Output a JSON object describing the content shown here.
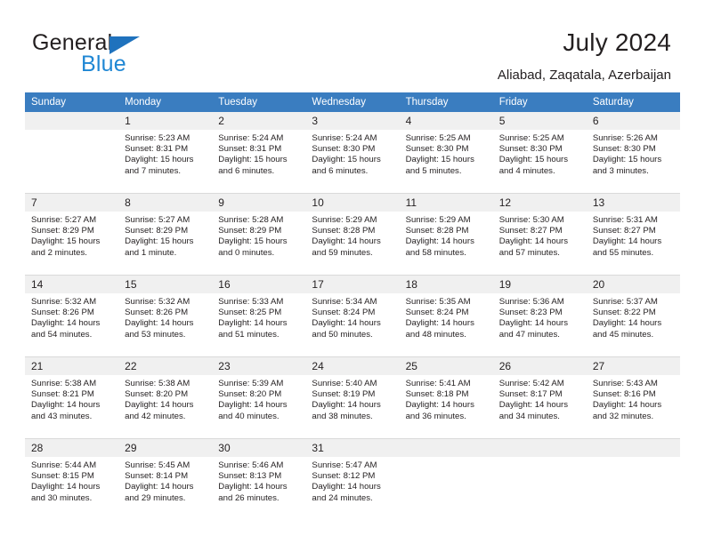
{
  "brand": {
    "name_top": "General",
    "name_bottom": "Blue",
    "accent_color": "#1f87d4",
    "triangle_color": "#1f72bd"
  },
  "header": {
    "title": "July 2024",
    "subtitle": "Aliabad, Zaqatala, Azerbaijan"
  },
  "calendar": {
    "header_bg": "#3a7dc0",
    "daynum_bg": "#f0f0f0",
    "weekday_headers": [
      "Sunday",
      "Monday",
      "Tuesday",
      "Wednesday",
      "Thursday",
      "Friday",
      "Saturday"
    ],
    "weeks": [
      [
        {
          "day": "",
          "sunrise": "",
          "sunset": "",
          "daylight_line1": "",
          "daylight_line2": "",
          "empty": true
        },
        {
          "day": "1",
          "sunrise": "Sunrise: 5:23 AM",
          "sunset": "Sunset: 8:31 PM",
          "daylight_line1": "Daylight: 15 hours",
          "daylight_line2": "and 7 minutes."
        },
        {
          "day": "2",
          "sunrise": "Sunrise: 5:24 AM",
          "sunset": "Sunset: 8:31 PM",
          "daylight_line1": "Daylight: 15 hours",
          "daylight_line2": "and 6 minutes."
        },
        {
          "day": "3",
          "sunrise": "Sunrise: 5:24 AM",
          "sunset": "Sunset: 8:30 PM",
          "daylight_line1": "Daylight: 15 hours",
          "daylight_line2": "and 6 minutes."
        },
        {
          "day": "4",
          "sunrise": "Sunrise: 5:25 AM",
          "sunset": "Sunset: 8:30 PM",
          "daylight_line1": "Daylight: 15 hours",
          "daylight_line2": "and 5 minutes."
        },
        {
          "day": "5",
          "sunrise": "Sunrise: 5:25 AM",
          "sunset": "Sunset: 8:30 PM",
          "daylight_line1": "Daylight: 15 hours",
          "daylight_line2": "and 4 minutes."
        },
        {
          "day": "6",
          "sunrise": "Sunrise: 5:26 AM",
          "sunset": "Sunset: 8:30 PM",
          "daylight_line1": "Daylight: 15 hours",
          "daylight_line2": "and 3 minutes."
        }
      ],
      [
        {
          "day": "7",
          "sunrise": "Sunrise: 5:27 AM",
          "sunset": "Sunset: 8:29 PM",
          "daylight_line1": "Daylight: 15 hours",
          "daylight_line2": "and 2 minutes."
        },
        {
          "day": "8",
          "sunrise": "Sunrise: 5:27 AM",
          "sunset": "Sunset: 8:29 PM",
          "daylight_line1": "Daylight: 15 hours",
          "daylight_line2": "and 1 minute."
        },
        {
          "day": "9",
          "sunrise": "Sunrise: 5:28 AM",
          "sunset": "Sunset: 8:29 PM",
          "daylight_line1": "Daylight: 15 hours",
          "daylight_line2": "and 0 minutes."
        },
        {
          "day": "10",
          "sunrise": "Sunrise: 5:29 AM",
          "sunset": "Sunset: 8:28 PM",
          "daylight_line1": "Daylight: 14 hours",
          "daylight_line2": "and 59 minutes."
        },
        {
          "day": "11",
          "sunrise": "Sunrise: 5:29 AM",
          "sunset": "Sunset: 8:28 PM",
          "daylight_line1": "Daylight: 14 hours",
          "daylight_line2": "and 58 minutes."
        },
        {
          "day": "12",
          "sunrise": "Sunrise: 5:30 AM",
          "sunset": "Sunset: 8:27 PM",
          "daylight_line1": "Daylight: 14 hours",
          "daylight_line2": "and 57 minutes."
        },
        {
          "day": "13",
          "sunrise": "Sunrise: 5:31 AM",
          "sunset": "Sunset: 8:27 PM",
          "daylight_line1": "Daylight: 14 hours",
          "daylight_line2": "and 55 minutes."
        }
      ],
      [
        {
          "day": "14",
          "sunrise": "Sunrise: 5:32 AM",
          "sunset": "Sunset: 8:26 PM",
          "daylight_line1": "Daylight: 14 hours",
          "daylight_line2": "and 54 minutes."
        },
        {
          "day": "15",
          "sunrise": "Sunrise: 5:32 AM",
          "sunset": "Sunset: 8:26 PM",
          "daylight_line1": "Daylight: 14 hours",
          "daylight_line2": "and 53 minutes."
        },
        {
          "day": "16",
          "sunrise": "Sunrise: 5:33 AM",
          "sunset": "Sunset: 8:25 PM",
          "daylight_line1": "Daylight: 14 hours",
          "daylight_line2": "and 51 minutes."
        },
        {
          "day": "17",
          "sunrise": "Sunrise: 5:34 AM",
          "sunset": "Sunset: 8:24 PM",
          "daylight_line1": "Daylight: 14 hours",
          "daylight_line2": "and 50 minutes."
        },
        {
          "day": "18",
          "sunrise": "Sunrise: 5:35 AM",
          "sunset": "Sunset: 8:24 PM",
          "daylight_line1": "Daylight: 14 hours",
          "daylight_line2": "and 48 minutes."
        },
        {
          "day": "19",
          "sunrise": "Sunrise: 5:36 AM",
          "sunset": "Sunset: 8:23 PM",
          "daylight_line1": "Daylight: 14 hours",
          "daylight_line2": "and 47 minutes."
        },
        {
          "day": "20",
          "sunrise": "Sunrise: 5:37 AM",
          "sunset": "Sunset: 8:22 PM",
          "daylight_line1": "Daylight: 14 hours",
          "daylight_line2": "and 45 minutes."
        }
      ],
      [
        {
          "day": "21",
          "sunrise": "Sunrise: 5:38 AM",
          "sunset": "Sunset: 8:21 PM",
          "daylight_line1": "Daylight: 14 hours",
          "daylight_line2": "and 43 minutes."
        },
        {
          "day": "22",
          "sunrise": "Sunrise: 5:38 AM",
          "sunset": "Sunset: 8:20 PM",
          "daylight_line1": "Daylight: 14 hours",
          "daylight_line2": "and 42 minutes."
        },
        {
          "day": "23",
          "sunrise": "Sunrise: 5:39 AM",
          "sunset": "Sunset: 8:20 PM",
          "daylight_line1": "Daylight: 14 hours",
          "daylight_line2": "and 40 minutes."
        },
        {
          "day": "24",
          "sunrise": "Sunrise: 5:40 AM",
          "sunset": "Sunset: 8:19 PM",
          "daylight_line1": "Daylight: 14 hours",
          "daylight_line2": "and 38 minutes."
        },
        {
          "day": "25",
          "sunrise": "Sunrise: 5:41 AM",
          "sunset": "Sunset: 8:18 PM",
          "daylight_line1": "Daylight: 14 hours",
          "daylight_line2": "and 36 minutes."
        },
        {
          "day": "26",
          "sunrise": "Sunrise: 5:42 AM",
          "sunset": "Sunset: 8:17 PM",
          "daylight_line1": "Daylight: 14 hours",
          "daylight_line2": "and 34 minutes."
        },
        {
          "day": "27",
          "sunrise": "Sunrise: 5:43 AM",
          "sunset": "Sunset: 8:16 PM",
          "daylight_line1": "Daylight: 14 hours",
          "daylight_line2": "and 32 minutes."
        }
      ],
      [
        {
          "day": "28",
          "sunrise": "Sunrise: 5:44 AM",
          "sunset": "Sunset: 8:15 PM",
          "daylight_line1": "Daylight: 14 hours",
          "daylight_line2": "and 30 minutes."
        },
        {
          "day": "29",
          "sunrise": "Sunrise: 5:45 AM",
          "sunset": "Sunset: 8:14 PM",
          "daylight_line1": "Daylight: 14 hours",
          "daylight_line2": "and 29 minutes."
        },
        {
          "day": "30",
          "sunrise": "Sunrise: 5:46 AM",
          "sunset": "Sunset: 8:13 PM",
          "daylight_line1": "Daylight: 14 hours",
          "daylight_line2": "and 26 minutes."
        },
        {
          "day": "31",
          "sunrise": "Sunrise: 5:47 AM",
          "sunset": "Sunset: 8:12 PM",
          "daylight_line1": "Daylight: 14 hours",
          "daylight_line2": "and 24 minutes."
        },
        {
          "day": "",
          "sunrise": "",
          "sunset": "",
          "daylight_line1": "",
          "daylight_line2": "",
          "empty": true
        },
        {
          "day": "",
          "sunrise": "",
          "sunset": "",
          "daylight_line1": "",
          "daylight_line2": "",
          "empty": true
        },
        {
          "day": "",
          "sunrise": "",
          "sunset": "",
          "daylight_line1": "",
          "daylight_line2": "",
          "empty": true
        }
      ]
    ]
  }
}
